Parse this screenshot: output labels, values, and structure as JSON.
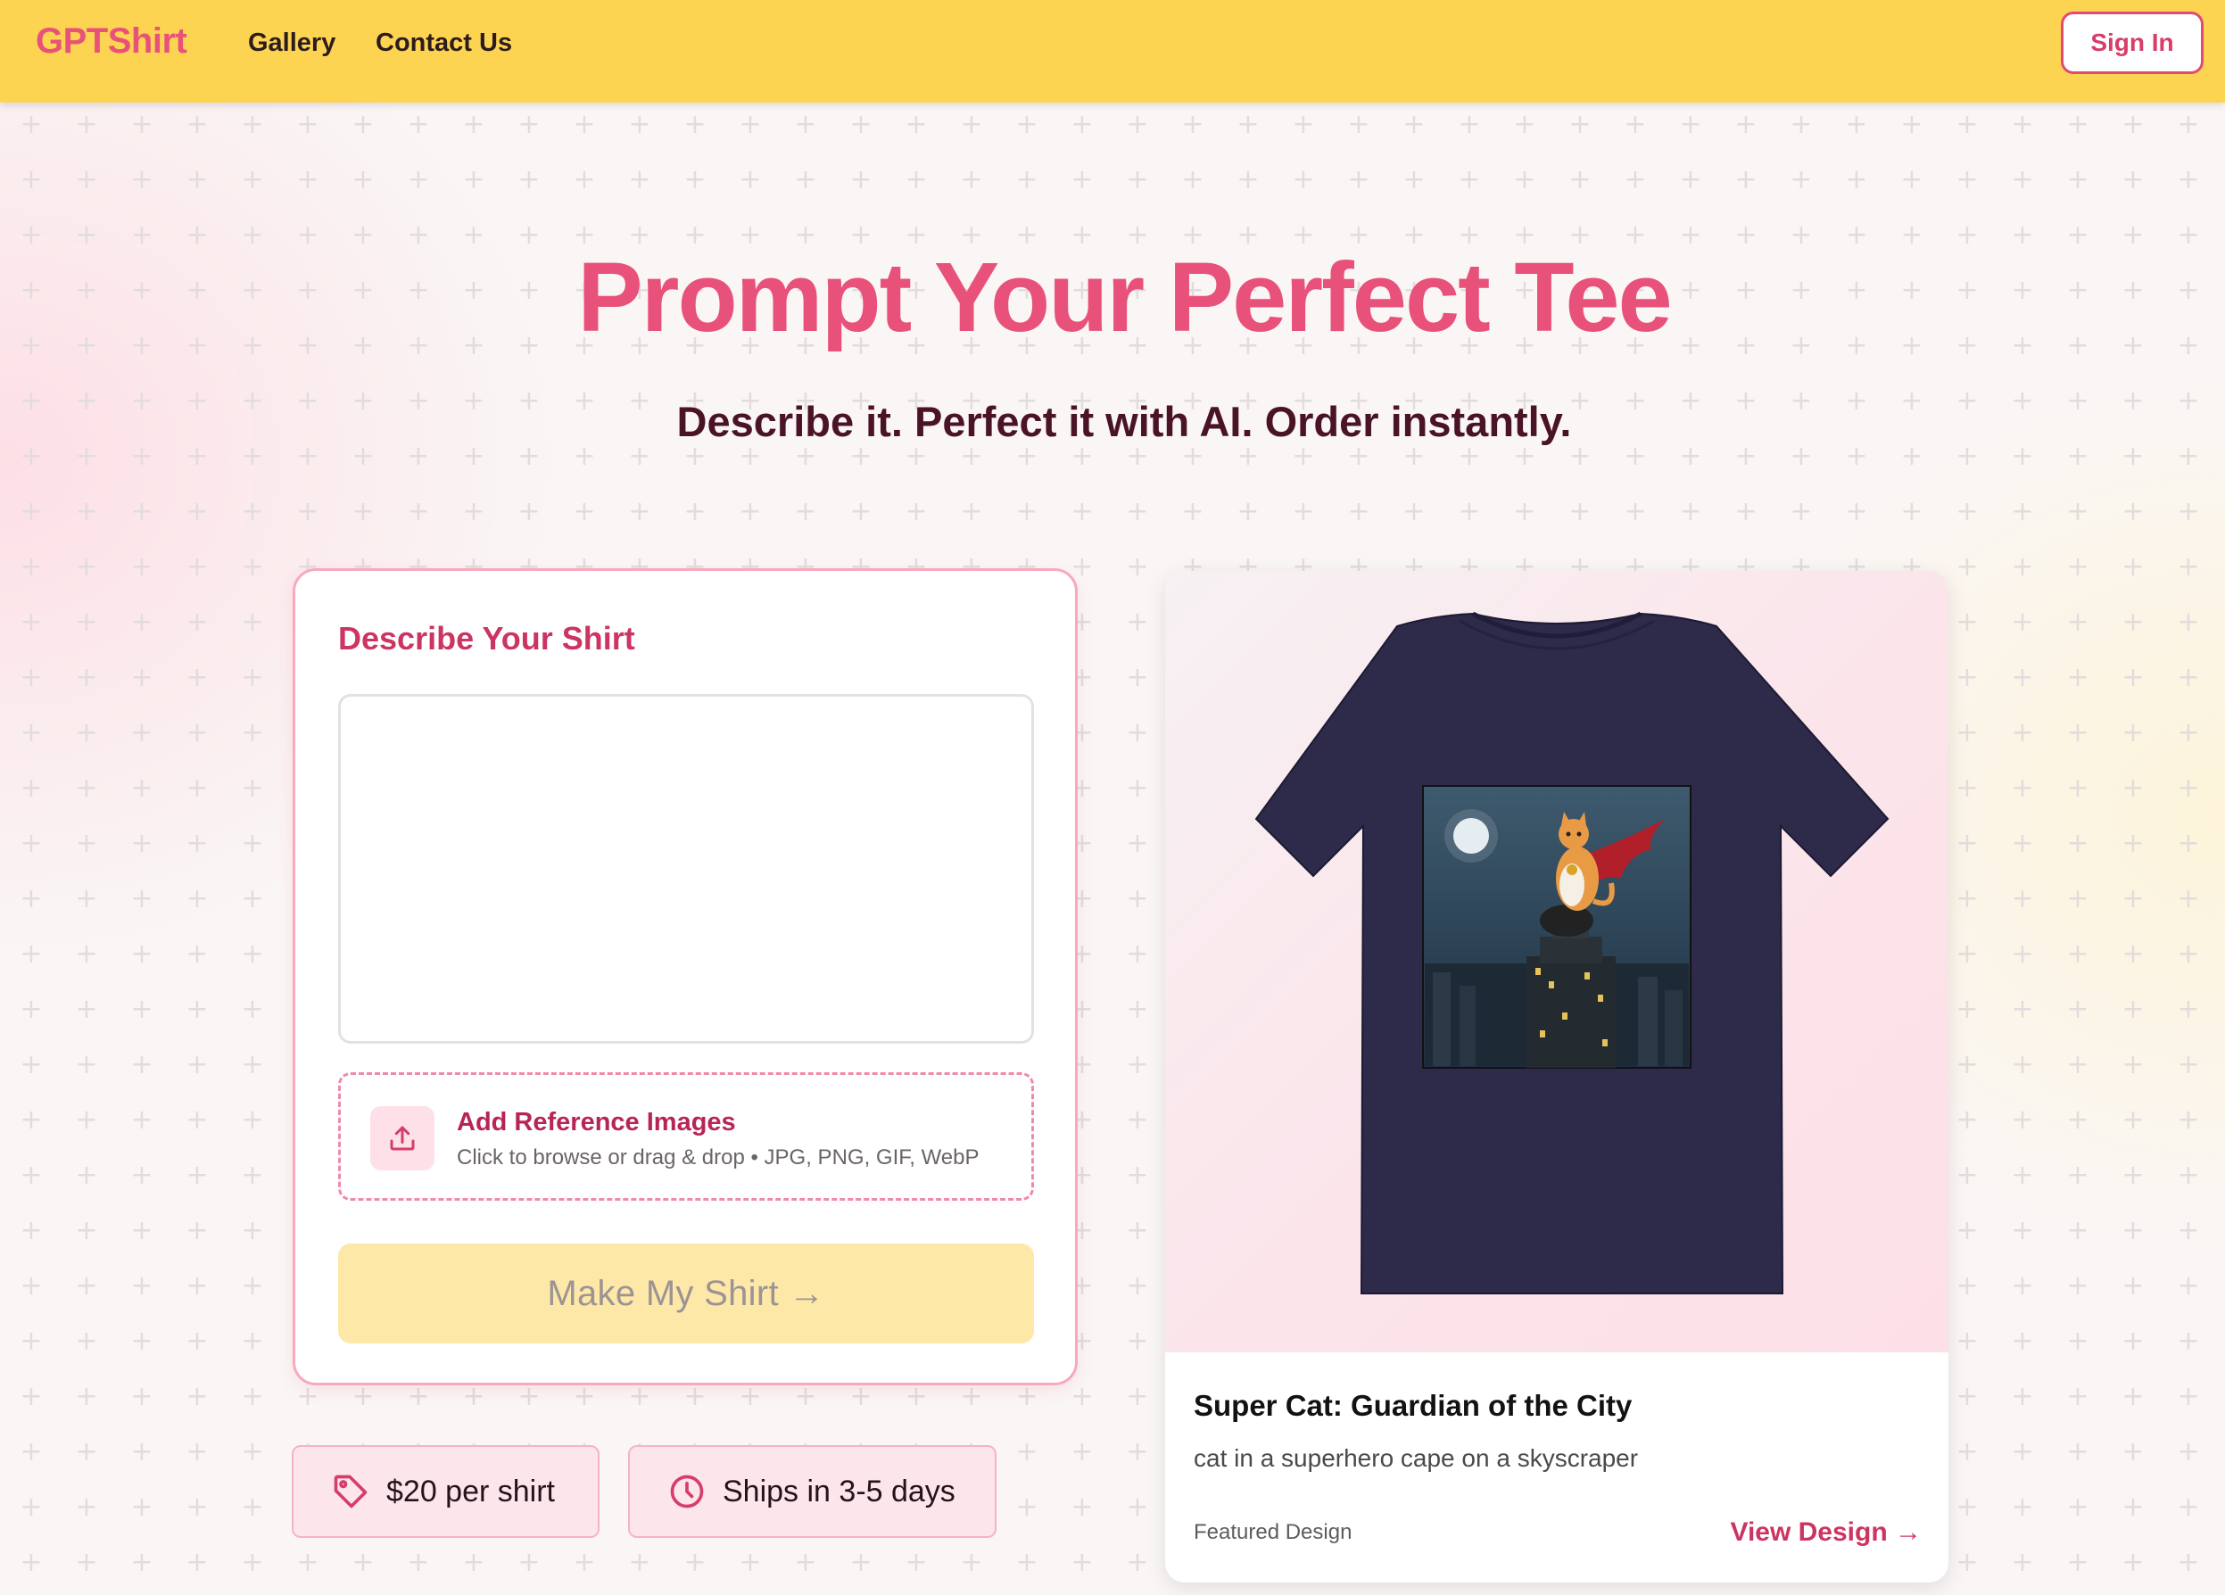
{
  "header": {
    "brand": "GPTShirt",
    "nav": [
      "Gallery",
      "Contact Us"
    ],
    "sign_in": "Sign In"
  },
  "hero": {
    "title": "Prompt Your Perfect Tee",
    "subtitle": "Describe it. Perfect it with AI. Order instantly."
  },
  "form": {
    "title": "Describe Your Shirt",
    "prompt_value": "",
    "upload_title": "Add Reference Images",
    "upload_subtitle": "Click to browse or drag & drop • JPG, PNG, GIF, WebP",
    "submit_label": "Make My Shirt →"
  },
  "badges": {
    "price": "$20 per shirt",
    "shipping": "Ships in 3-5 days"
  },
  "featured_design": {
    "title": "Super Cat: Guardian of the City",
    "description": "cat in a superhero cape on a skyscraper",
    "label": "Featured Design",
    "link": "View Design →"
  },
  "colors": {
    "header_bg": "#fdd451",
    "brand_pink": "#e8527a",
    "accent_dark_pink": "#cc3462",
    "button_disabled_bg": "#fde8a8",
    "shirt_navy": "#2d2a4a"
  },
  "icons": {
    "upload": "upload-icon",
    "price": "tag-icon",
    "shipping": "clock-icon"
  }
}
